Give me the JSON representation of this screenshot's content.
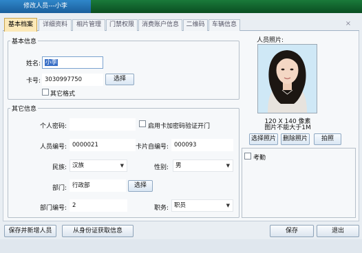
{
  "window": {
    "title": "修改人员---小李"
  },
  "tabs": [
    "基本档案",
    "详细资料",
    "相片管理",
    "门禁权限",
    "消费账户信息",
    "二维码",
    "车辆信息"
  ],
  "basic": {
    "group_title": "基本信息",
    "name_label": "姓名:",
    "name_value": "小李",
    "card_label": "卡号:",
    "card_value": "3030997750",
    "select_label": "选择",
    "other_format_label": "其它格式"
  },
  "other": {
    "group_title": "其它信息",
    "password_label": "个人密码:",
    "password_value": "",
    "enable_pwd_label": "启用卡加密码验证开门",
    "emp_no_label": "人员编号:",
    "emp_no_value": "0000021",
    "card_self_no_label": "卡片自编号:",
    "card_self_no_value": "000093",
    "nation_label": "民族:",
    "nation_value": "汉族",
    "gender_label": "性别:",
    "gender_value": "男",
    "dept_label": "部门:",
    "dept_value": "行政部",
    "dept_select_label": "选择",
    "dept_no_label": "部门编号:",
    "dept_no_value": "2",
    "job_label": "职务:",
    "job_value": "职员"
  },
  "photo": {
    "title": "人员照片:",
    "size_line1": "120 X 140 像素",
    "size_line2": "图片不能大于1M",
    "select_photo": "选择照片",
    "delete_photo": "删除照片",
    "take_photo": "拍照"
  },
  "attendance": {
    "label": "考勤"
  },
  "footer": {
    "save_add": "保存并新增人员",
    "read_id": "从身份证获取信息",
    "save": "保存",
    "exit": "退出"
  },
  "colors": {
    "accent": "#3a70c7",
    "active_tab": "#fce9b8",
    "title_bar": "#1a5f9c"
  }
}
